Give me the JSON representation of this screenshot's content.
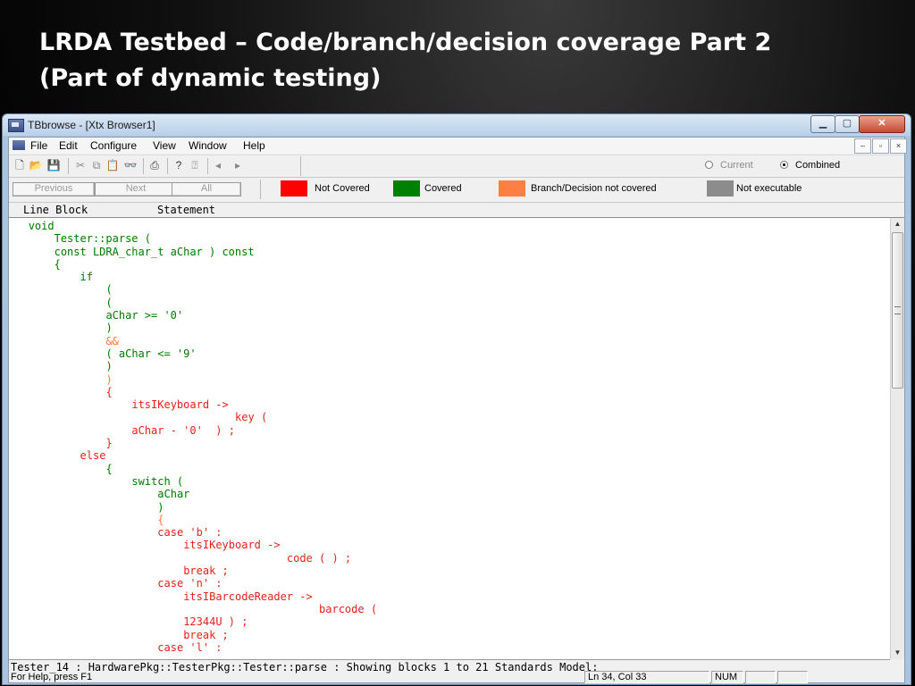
{
  "slide": {
    "title_line1": "LRDA Testbed – Code/branch/decision coverage Part 2",
    "title_line2": "(Part of dynamic testing)"
  },
  "window": {
    "title": "TBbrowse - [Xtx Browser1]",
    "controls": {
      "minimize": "▁",
      "maximize": "▢",
      "close": "✕"
    }
  },
  "menu": {
    "items": [
      "File",
      "Edit",
      "Configure",
      "View",
      "Window",
      "Help"
    ],
    "mdi_controls": [
      "–",
      "▫",
      "×"
    ]
  },
  "toolbar": {
    "icons": [
      "new-file-icon",
      "open-folder-icon",
      "save-icon",
      "cut-icon",
      "copy-icon",
      "paste-icon",
      "find-binoculars-icon",
      "print-icon",
      "help-icon",
      "context-help-icon",
      "back-arrow-icon",
      "forward-arrow-icon"
    ],
    "view_mode": {
      "option_current": "Current",
      "option_combined": "Combined",
      "selected": "Combined"
    }
  },
  "navigation": {
    "previous_label": "Previous",
    "next_label": "Next",
    "all_label": "All"
  },
  "legend": [
    {
      "label": "Not Covered",
      "color": "#ff0000"
    },
    {
      "label": "Covered",
      "color": "#008000"
    },
    {
      "label": "Branch/Decision not covered",
      "color": "#ff7f40"
    },
    {
      "label": "Not executable",
      "color": "#8c8c8c"
    }
  ],
  "columns": {
    "line_block": "Line Block",
    "statement": "Statement"
  },
  "code_lines": [
    {
      "indent": 3,
      "text": "void",
      "status": "covered"
    },
    {
      "indent": 7,
      "text": "Tester::parse (",
      "status": "covered"
    },
    {
      "indent": 7,
      "text": "const LDRA_char_t aChar ) const",
      "status": "covered"
    },
    {
      "indent": 7,
      "text": "{",
      "status": "covered"
    },
    {
      "indent": 11,
      "text": "if",
      "status": "covered"
    },
    {
      "indent": 15,
      "text": "(",
      "status": "covered"
    },
    {
      "indent": 15,
      "text": "(",
      "status": "covered"
    },
    {
      "indent": 15,
      "text": "aChar >= '0'",
      "status": "covered"
    },
    {
      "indent": 15,
      "text": ")",
      "status": "covered"
    },
    {
      "indent": 15,
      "text": "&&",
      "status": "branch"
    },
    {
      "indent": 15,
      "text": "( aChar <= '9'",
      "status": "covered"
    },
    {
      "indent": 15,
      "text": ")",
      "status": "covered"
    },
    {
      "indent": 15,
      "text": ")",
      "status": "branch"
    },
    {
      "indent": 15,
      "text": "{",
      "status": "not-covered"
    },
    {
      "indent": 19,
      "text": "itsIKeyboard ->",
      "status": "not-covered"
    },
    {
      "indent": 35,
      "text": "key (",
      "status": "not-covered"
    },
    {
      "indent": 19,
      "text": "aChar - '0'  ) ;",
      "status": "not-covered"
    },
    {
      "indent": 15,
      "text": "}",
      "status": "not-covered"
    },
    {
      "indent": 11,
      "text": "else",
      "status": "not-covered"
    },
    {
      "indent": 15,
      "text": "{",
      "status": "covered"
    },
    {
      "indent": 19,
      "text": "switch (",
      "status": "covered"
    },
    {
      "indent": 23,
      "text": "aChar",
      "status": "covered"
    },
    {
      "indent": 23,
      "text": ")",
      "status": "covered"
    },
    {
      "indent": 23,
      "text": "{",
      "status": "branch"
    },
    {
      "indent": 23,
      "text": "case 'b' :",
      "status": "not-covered"
    },
    {
      "indent": 27,
      "text": "itsIKeyboard ->",
      "status": "not-covered"
    },
    {
      "indent": 43,
      "text": "code ( ) ;",
      "status": "not-covered"
    },
    {
      "indent": 27,
      "text": "break ;",
      "status": "not-covered"
    },
    {
      "indent": 23,
      "text": "case 'n' :",
      "status": "not-covered"
    },
    {
      "indent": 27,
      "text": "itsIBarcodeReader ->",
      "status": "not-covered"
    },
    {
      "indent": 48,
      "text": "barcode (",
      "status": "not-covered"
    },
    {
      "indent": 27,
      "text": "12344U ) ;",
      "status": "not-covered"
    },
    {
      "indent": 27,
      "text": "break ;",
      "status": "not-covered"
    },
    {
      "indent": 23,
      "text": "case 'l' :",
      "status": "not-covered"
    }
  ],
  "info_line": "Tester_14 : HardwarePkg::TesterPkg::Tester::parse : Showing blocks 1 to 21  Standards Model:",
  "status_bar": {
    "help_text": "For Help, press F1",
    "position": "Ln 34, Col 33",
    "num_indicator": "NUM"
  }
}
